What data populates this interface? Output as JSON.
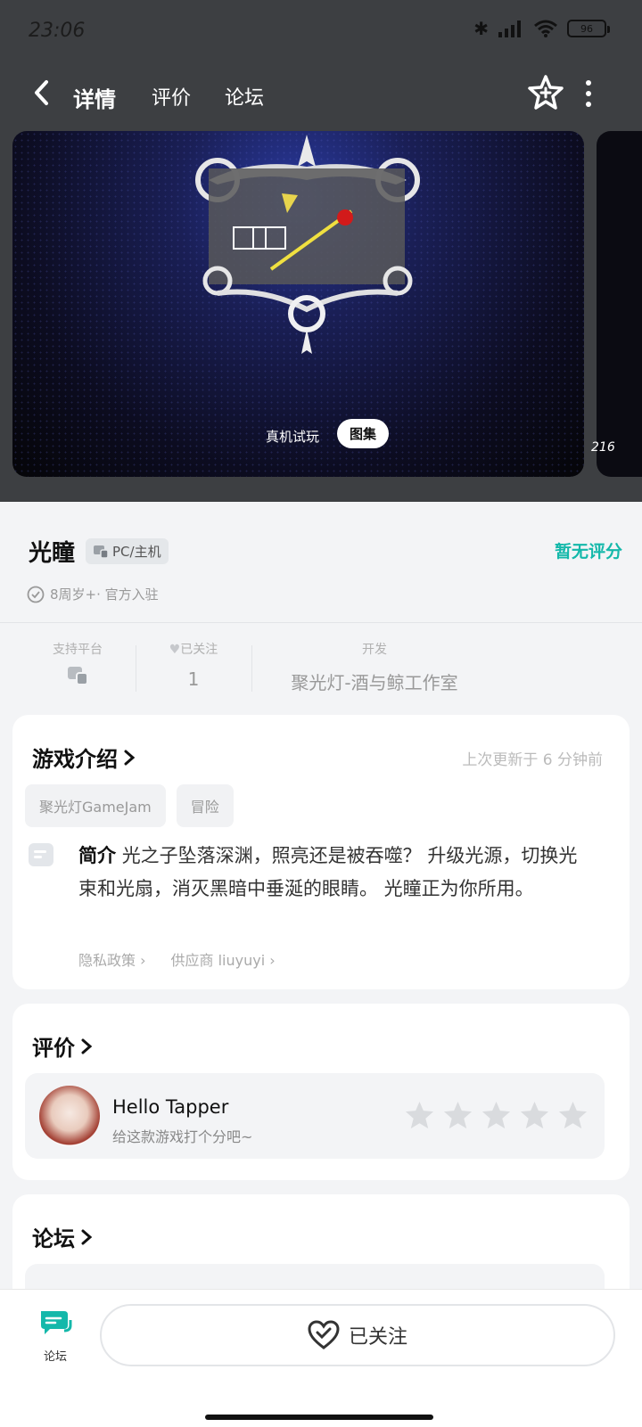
{
  "status_bar": {
    "time": "23:06",
    "battery": "96"
  },
  "nav": {
    "tabs": [
      "详情",
      "评价",
      "论坛"
    ]
  },
  "banner": {
    "tag_text": "真机试玩",
    "tag_pill": "图集",
    "count": "216"
  },
  "game": {
    "title": "光瞳",
    "platform": "PC/主机",
    "rating": "暂无评分",
    "meta": "8周岁+· 官方入驻"
  },
  "stats": {
    "platform_label": "支持平台",
    "follow_label": "已关注",
    "follow_count": "1",
    "dev_label": "开发",
    "dev_value": "聚光灯-酒与鲸工作室"
  },
  "intro": {
    "title": "游戏介绍",
    "updated": "上次更新于 6 分钟前",
    "tags": [
      "聚光灯GameJam",
      "冒险"
    ],
    "desc_label": "简介",
    "desc": "光之子坠落深渊，照亮还是被吞噬？ 升级光源，切换光束和光扇，消灭黑暗中垂涎的眼睛。 光瞳正为你所用。",
    "links": [
      "隐私政策",
      "供应商 liuyuyi"
    ]
  },
  "review": {
    "title": "评价",
    "user": "Hello Tapper",
    "hint": "给这款游戏打个分吧~",
    "stars": 5
  },
  "forum": {
    "title": "论坛"
  },
  "bottom": {
    "forum_label": "论坛",
    "follow_button": "已关注"
  },
  "colors": {
    "accent": "#14b8aa",
    "top_bg": "#3d3f42"
  }
}
